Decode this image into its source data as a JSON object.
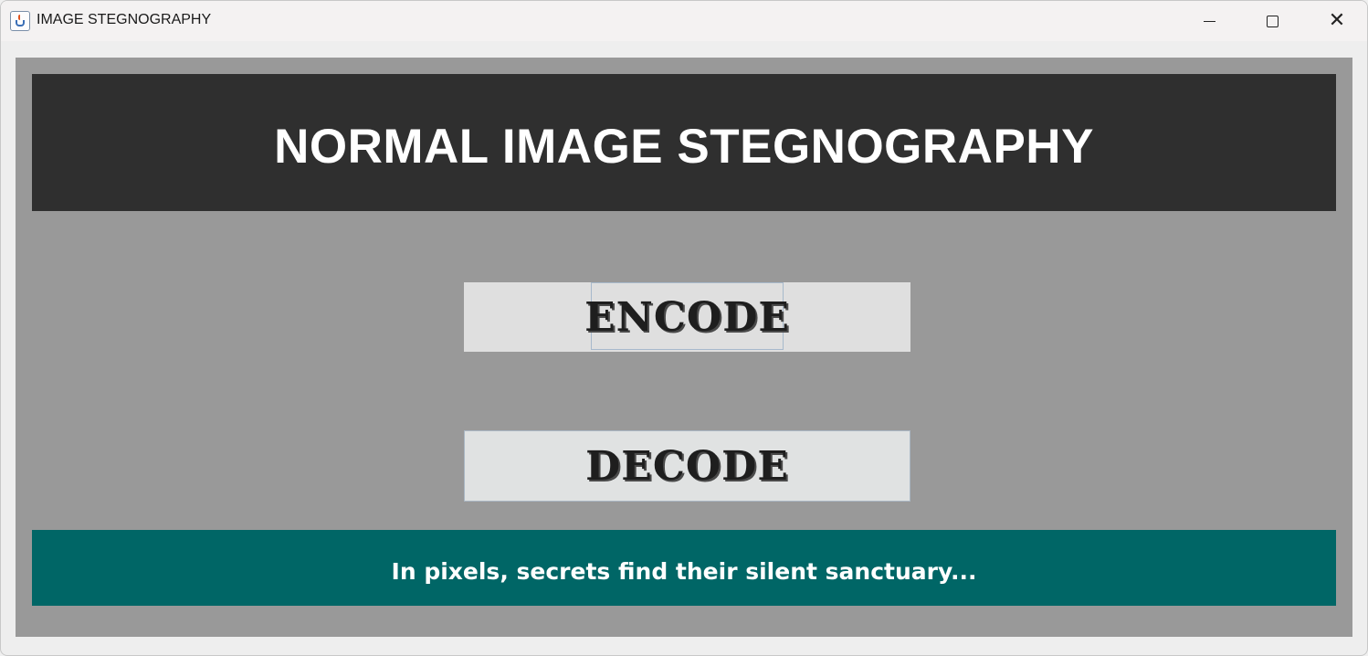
{
  "window": {
    "title": "IMAGE STEGNOGRAPHY",
    "controls": {
      "minimize": "minimize",
      "maximize": "maximize",
      "close": "close"
    }
  },
  "header": {
    "title": "NORMAL IMAGE STEGNOGRAPHY"
  },
  "actions": {
    "encode_label": "ENCODE",
    "decode_label": "DECODE"
  },
  "footer": {
    "tagline": "In pixels, secrets find their silent sanctuary..."
  },
  "colors": {
    "frame": "#999999",
    "header_bg": "#2f2f2f",
    "footer_bg": "#006666",
    "button_bg": "#dfdfdf"
  },
  "icons": {
    "app": "java-cup-icon",
    "minimize": "minimize-icon",
    "maximize": "maximize-icon",
    "close": "close-icon"
  }
}
